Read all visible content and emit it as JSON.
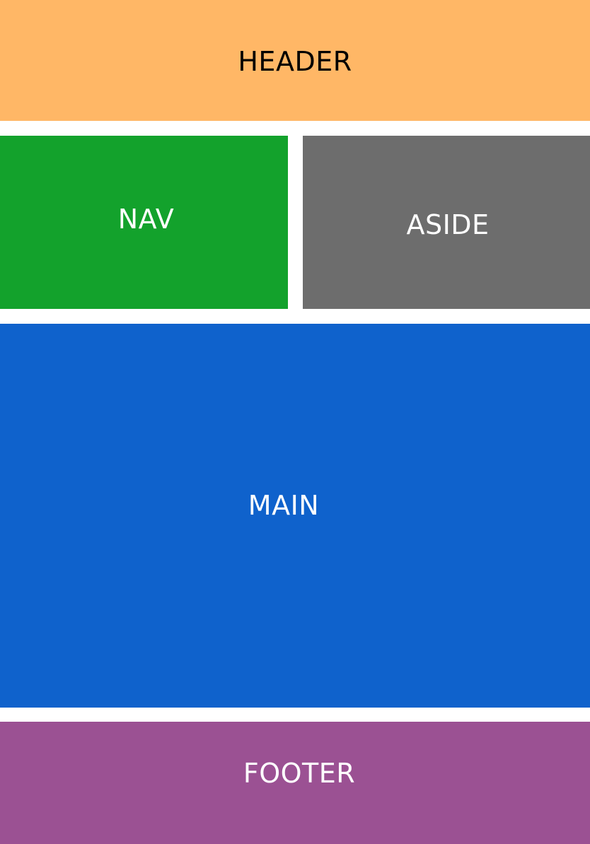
{
  "layout": {
    "header": {
      "label": "HEADER",
      "bg": "#FFB766",
      "fg": "#000000"
    },
    "nav": {
      "label": "NAV",
      "bg": "#13A22C",
      "fg": "#FFFFFF"
    },
    "aside": {
      "label": "ASIDE",
      "bg": "#6D6D6D",
      "fg": "#FFFFFF"
    },
    "main": {
      "label": "MAIN",
      "bg": "#0F62CC",
      "fg": "#FFFFFF"
    },
    "footer": {
      "label": "FOOTER",
      "bg": "#9B5193",
      "fg": "#FFFFFF"
    }
  },
  "page": {
    "bg": "#FFFFFF"
  }
}
